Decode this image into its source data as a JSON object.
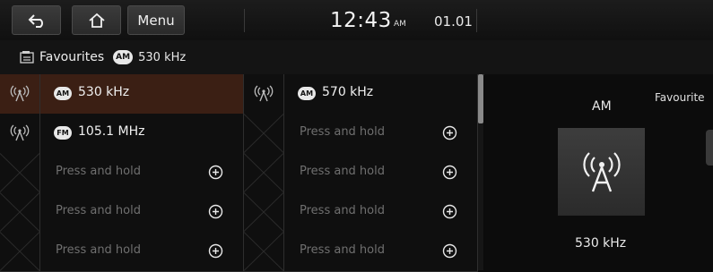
{
  "topbar": {
    "menu_label": "Menu",
    "time": "12:43",
    "ampm": "AM",
    "date": "01.01"
  },
  "subheader": {
    "title": "Favourites",
    "band": "AM",
    "frequency": "530 kHz"
  },
  "presets": {
    "left": [
      {
        "status": "filled",
        "band": "AM",
        "frequency": "530 kHz",
        "active": true
      },
      {
        "status": "filled",
        "band": "FM",
        "frequency": "105.1 MHz",
        "active": false
      },
      {
        "status": "empty",
        "hint": "Press and hold"
      },
      {
        "status": "empty",
        "hint": "Press and hold"
      },
      {
        "status": "empty",
        "hint": "Press and hold"
      }
    ],
    "right": [
      {
        "status": "filled",
        "band": "AM",
        "frequency": "570 kHz",
        "active": false
      },
      {
        "status": "empty",
        "hint": "Press and hold"
      },
      {
        "status": "empty",
        "hint": "Press and hold"
      },
      {
        "status": "empty",
        "hint": "Press and hold"
      },
      {
        "status": "empty",
        "hint": "Press and hold"
      }
    ]
  },
  "now_playing": {
    "band": "AM",
    "favourites_label": "Favourite",
    "frequency": "530 kHz"
  },
  "colors": {
    "active_row": "#3b1f14",
    "background": "#0b0b0b"
  },
  "icons": {
    "back": "back-arrow-icon",
    "home": "home-icon",
    "favourites": "favourites-list-icon",
    "radio": "radio-antenna-icon",
    "add": "plus-circle-icon"
  }
}
